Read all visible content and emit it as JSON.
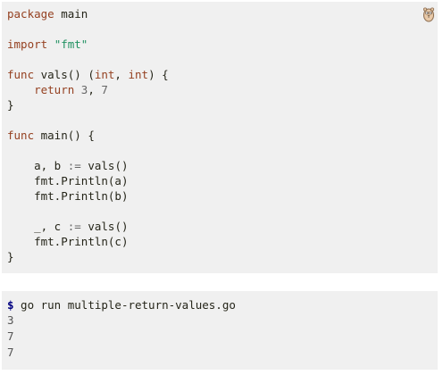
{
  "code": {
    "line1_kw": "package",
    "line1_rest": " main",
    "line3_kw": "import",
    "line3_str": "\"fmt\"",
    "line5_kw": "func",
    "line5_mid": " vals() (",
    "line5_t1": "int",
    "line5_sep": ", ",
    "line5_t2": "int",
    "line5_end": ") {",
    "line6_kw": "return",
    "line6_n1": "3",
    "line6_sep": ", ",
    "line6_n2": "7",
    "line7": "}",
    "line9_kw": "func",
    "line9_rest": " main() {",
    "line11_a": "a, b ",
    "line11_op": ":=",
    "line11_b": " vals()",
    "line12": "fmt.Println(a)",
    "line13": "fmt.Println(b)",
    "line15_a": "_, c ",
    "line15_op": ":=",
    "line15_b": " vals()",
    "line16": "fmt.Println(c)",
    "line17": "}"
  },
  "run_icon": "gopher-run-icon",
  "output": {
    "prompt": "$",
    "command": " go run multiple-return-values.go",
    "lines": [
      "3",
      "7",
      "7"
    ]
  }
}
